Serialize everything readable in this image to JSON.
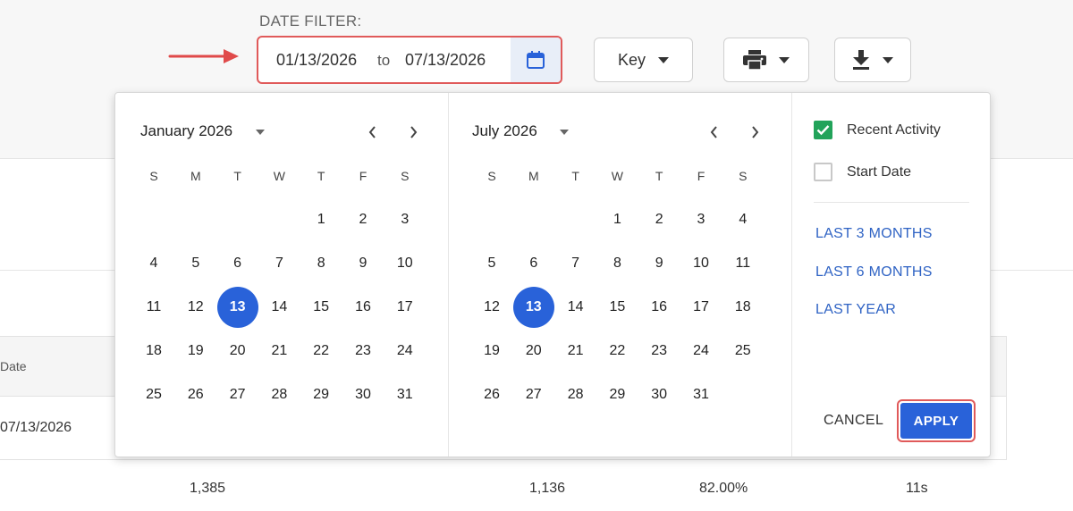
{
  "filter": {
    "label": "DATE FILTER:",
    "start": "01/13/2026",
    "to": "to",
    "end": "07/13/2026"
  },
  "toolbar": {
    "key_label": "Key"
  },
  "calendars": [
    {
      "title": "January 2026",
      "first_weekday": 4,
      "days": 31,
      "selected": 13
    },
    {
      "title": "July 2026",
      "first_weekday": 3,
      "days": 31,
      "selected": 13
    }
  ],
  "weekdays": [
    "S",
    "M",
    "T",
    "W",
    "T",
    "F",
    "S"
  ],
  "options": {
    "recent_activity": "Recent Activity",
    "recent_activity_checked": true,
    "start_date": "Start Date",
    "start_date_checked": false
  },
  "presets": [
    "LAST 3 MONTHS",
    "LAST 6 MONTHS",
    "LAST YEAR"
  ],
  "actions": {
    "cancel": "CANCEL",
    "apply": "APPLY"
  },
  "table": {
    "header_date": "Date",
    "row_date": "07/13/2026",
    "totals": [
      "1,385",
      "1,136",
      "82.00%",
      "11s"
    ]
  },
  "colors": {
    "accent": "#2962d9",
    "highlight_border": "#e05a5a",
    "checkbox_on": "#22a35a",
    "link": "#2f63c4"
  }
}
